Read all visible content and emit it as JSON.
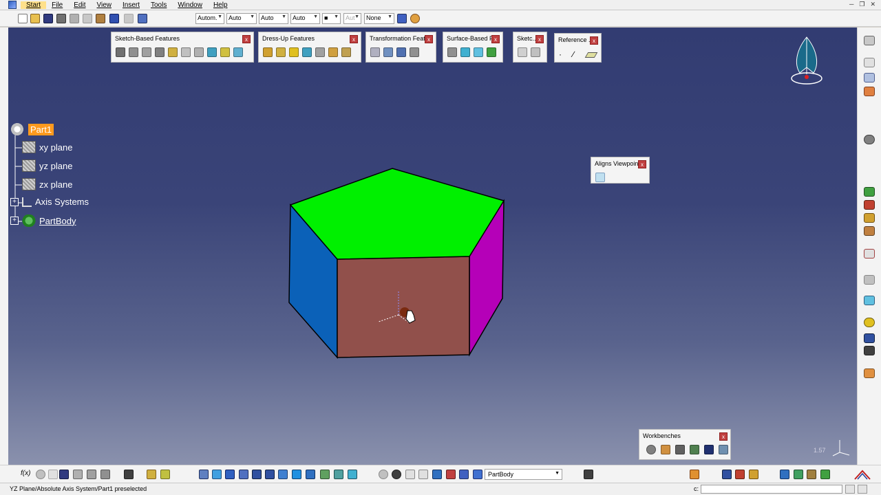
{
  "menubar": {
    "items": [
      "Start",
      "File",
      "Edit",
      "View",
      "Insert",
      "Tools",
      "Window",
      "Help"
    ]
  },
  "toolbar_top": {
    "dropdowns": [
      "Autom.",
      "Auto",
      "Auto",
      "Auto",
      "■",
      "Aut",
      "None"
    ]
  },
  "tree": {
    "root": "Part1",
    "children": [
      "xy plane",
      "yz plane",
      "zx plane",
      "Axis Systems",
      "PartBody"
    ]
  },
  "floating_toolbars": {
    "sketch_based": "Sketch-Based Features",
    "dress_up": "Dress-Up Features",
    "transformation": "Transformation Feat...",
    "surface_based": "Surface-Based F...",
    "sketcher": "Sketc...",
    "reference": "Reference ...",
    "aligns_viewpoint": "Aligns Viewpoint",
    "workbenches": "Workbenches",
    "close_glyph": "x"
  },
  "compass_axis_label": "1.57",
  "bottom_toolbar": {
    "body_selector": "PartBody",
    "formula_label": "f(x)"
  },
  "status": {
    "message": "YZ Plane/Absolute Axis System/Part1 preselected",
    "command_prompt": "c:"
  },
  "colors": {
    "top_face": "#00f000",
    "front_face": "#91504b",
    "left_face": "#0b61b8",
    "right_face": "#b500b8",
    "highlight": "#ff9a1e"
  }
}
